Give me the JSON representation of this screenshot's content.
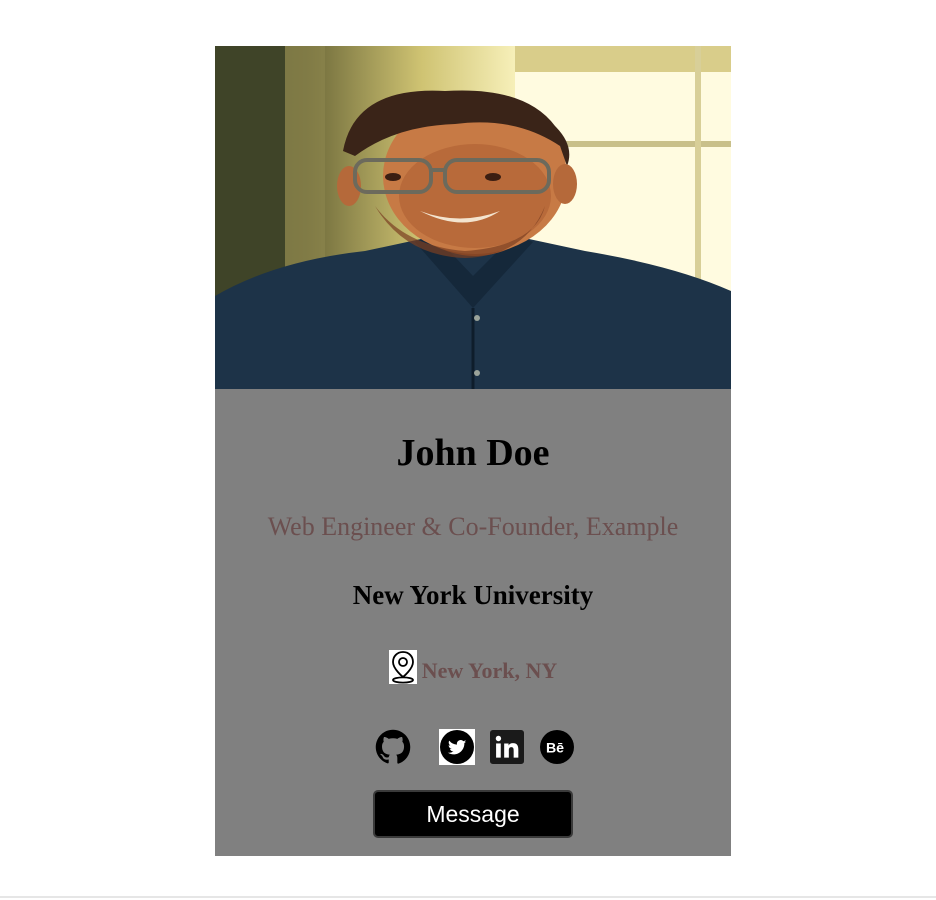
{
  "profile": {
    "photo_alt": "profile-photo",
    "name": "John Doe",
    "title": "Web Engineer & Co-Founder, Example",
    "school": "New York University",
    "location": "New York, NY"
  },
  "socials": [
    {
      "name": "github",
      "icon": "github-icon"
    },
    {
      "name": "twitter",
      "icon": "twitter-icon"
    },
    {
      "name": "linkedin",
      "icon": "linkedin-icon"
    },
    {
      "name": "behance",
      "icon": "behance-icon"
    }
  ],
  "actions": {
    "message_label": "Message"
  },
  "colors": {
    "card_background": "#808080",
    "subtitle_text": "#6b4f4f",
    "button_background": "#000000",
    "button_text": "#ffffff"
  }
}
